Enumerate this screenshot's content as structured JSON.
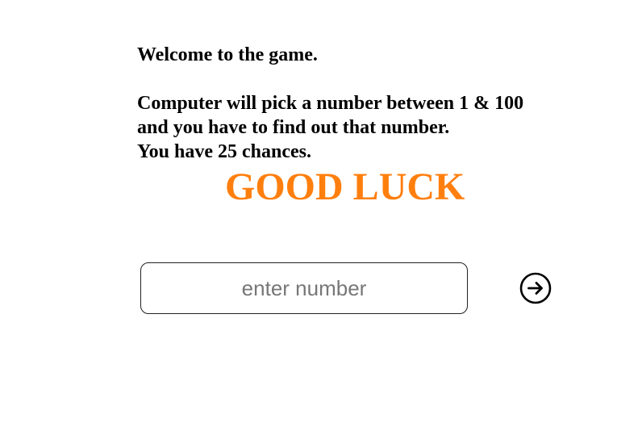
{
  "intro": {
    "welcome": "Welcome to the game.",
    "rules_line1": "Computer will pick a number between 1 & 100",
    "rules_line2": "and you have to find out that number.",
    "chances": "You have 25 chances."
  },
  "good_luck": "GOOD LUCK",
  "guess": {
    "placeholder": "enter number",
    "value": ""
  },
  "submit": {
    "icon": "arrow-right-circle-icon"
  },
  "colors": {
    "accent": "#ff7f0e",
    "text": "#000000",
    "background": "#ffffff"
  }
}
